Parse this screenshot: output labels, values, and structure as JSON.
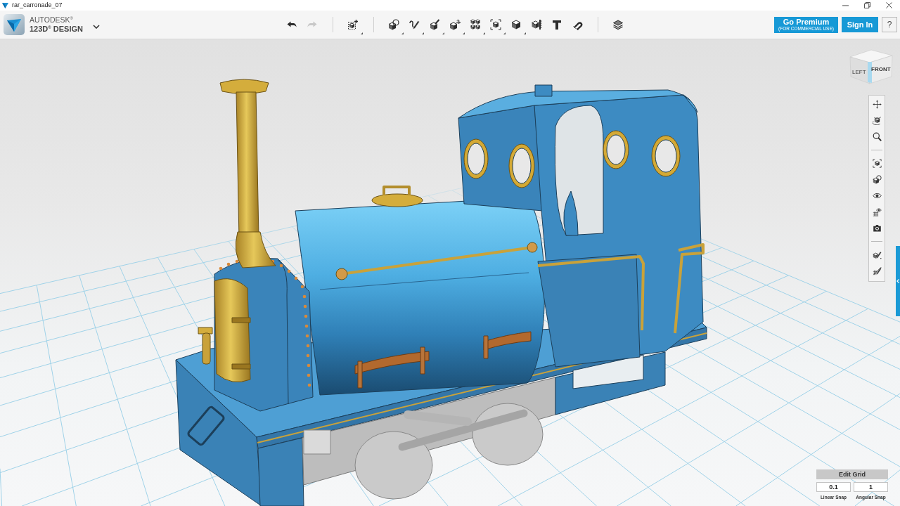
{
  "window": {
    "title": "rar_carronade_07"
  },
  "app_menu": {
    "brand_top": "AUTODESK$^{®}$",
    "brand_bottom": "123D$^{®}$ DESIGN"
  },
  "toolbar": {
    "groups": [
      {
        "items": [
          {
            "kind": "undo",
            "disabled": false,
            "has_menu": false
          },
          {
            "kind": "redo",
            "disabled": true,
            "has_menu": false
          }
        ]
      },
      {
        "items": [
          {
            "kind": "transform",
            "disabled": false,
            "has_menu": true
          }
        ]
      },
      {
        "items": [
          {
            "kind": "primitives",
            "disabled": false,
            "has_menu": true
          },
          {
            "kind": "sketch",
            "disabled": false,
            "has_menu": true
          },
          {
            "kind": "construct",
            "disabled": false,
            "has_menu": true
          },
          {
            "kind": "modify",
            "disabled": false,
            "has_menu": true
          },
          {
            "kind": "pattern",
            "disabled": false,
            "has_menu": true
          },
          {
            "kind": "grouping",
            "disabled": false,
            "has_menu": true
          },
          {
            "kind": "combine",
            "disabled": false,
            "has_menu": true
          },
          {
            "kind": "measure",
            "disabled": false,
            "has_menu": false
          },
          {
            "kind": "text",
            "disabled": false,
            "has_menu": false
          },
          {
            "kind": "snap",
            "disabled": false,
            "has_menu": false
          }
        ]
      },
      {
        "items": [
          {
            "kind": "material",
            "disabled": false,
            "has_menu": false
          }
        ]
      }
    ]
  },
  "account": {
    "premium": {
      "label": "Go Premium",
      "note": "(FOR COMMERCIAL USE)"
    },
    "sign_in": "Sign In",
    "help": "?"
  },
  "view_cube": {
    "left_face": "LEFT",
    "front_face": "FRONT"
  },
  "navigation": {
    "groups": [
      {
        "items": [
          {
            "kind": "pan"
          },
          {
            "kind": "orbit"
          },
          {
            "kind": "zoom"
          }
        ]
      },
      {
        "items": [
          {
            "kind": "fit"
          },
          {
            "kind": "views"
          },
          {
            "kind": "visibility"
          },
          {
            "kind": "materials"
          },
          {
            "kind": "screenshot"
          }
        ]
      },
      {
        "items": [
          {
            "kind": "snapgrid"
          },
          {
            "kind": "hidegrid"
          }
        ]
      }
    ]
  },
  "grid_settings": {
    "button": "Edit Grid",
    "fields": [
      {
        "value": "0.1",
        "label": "Linear Snap"
      },
      {
        "value": "1",
        "label": "Angular Snap"
      }
    ]
  }
}
